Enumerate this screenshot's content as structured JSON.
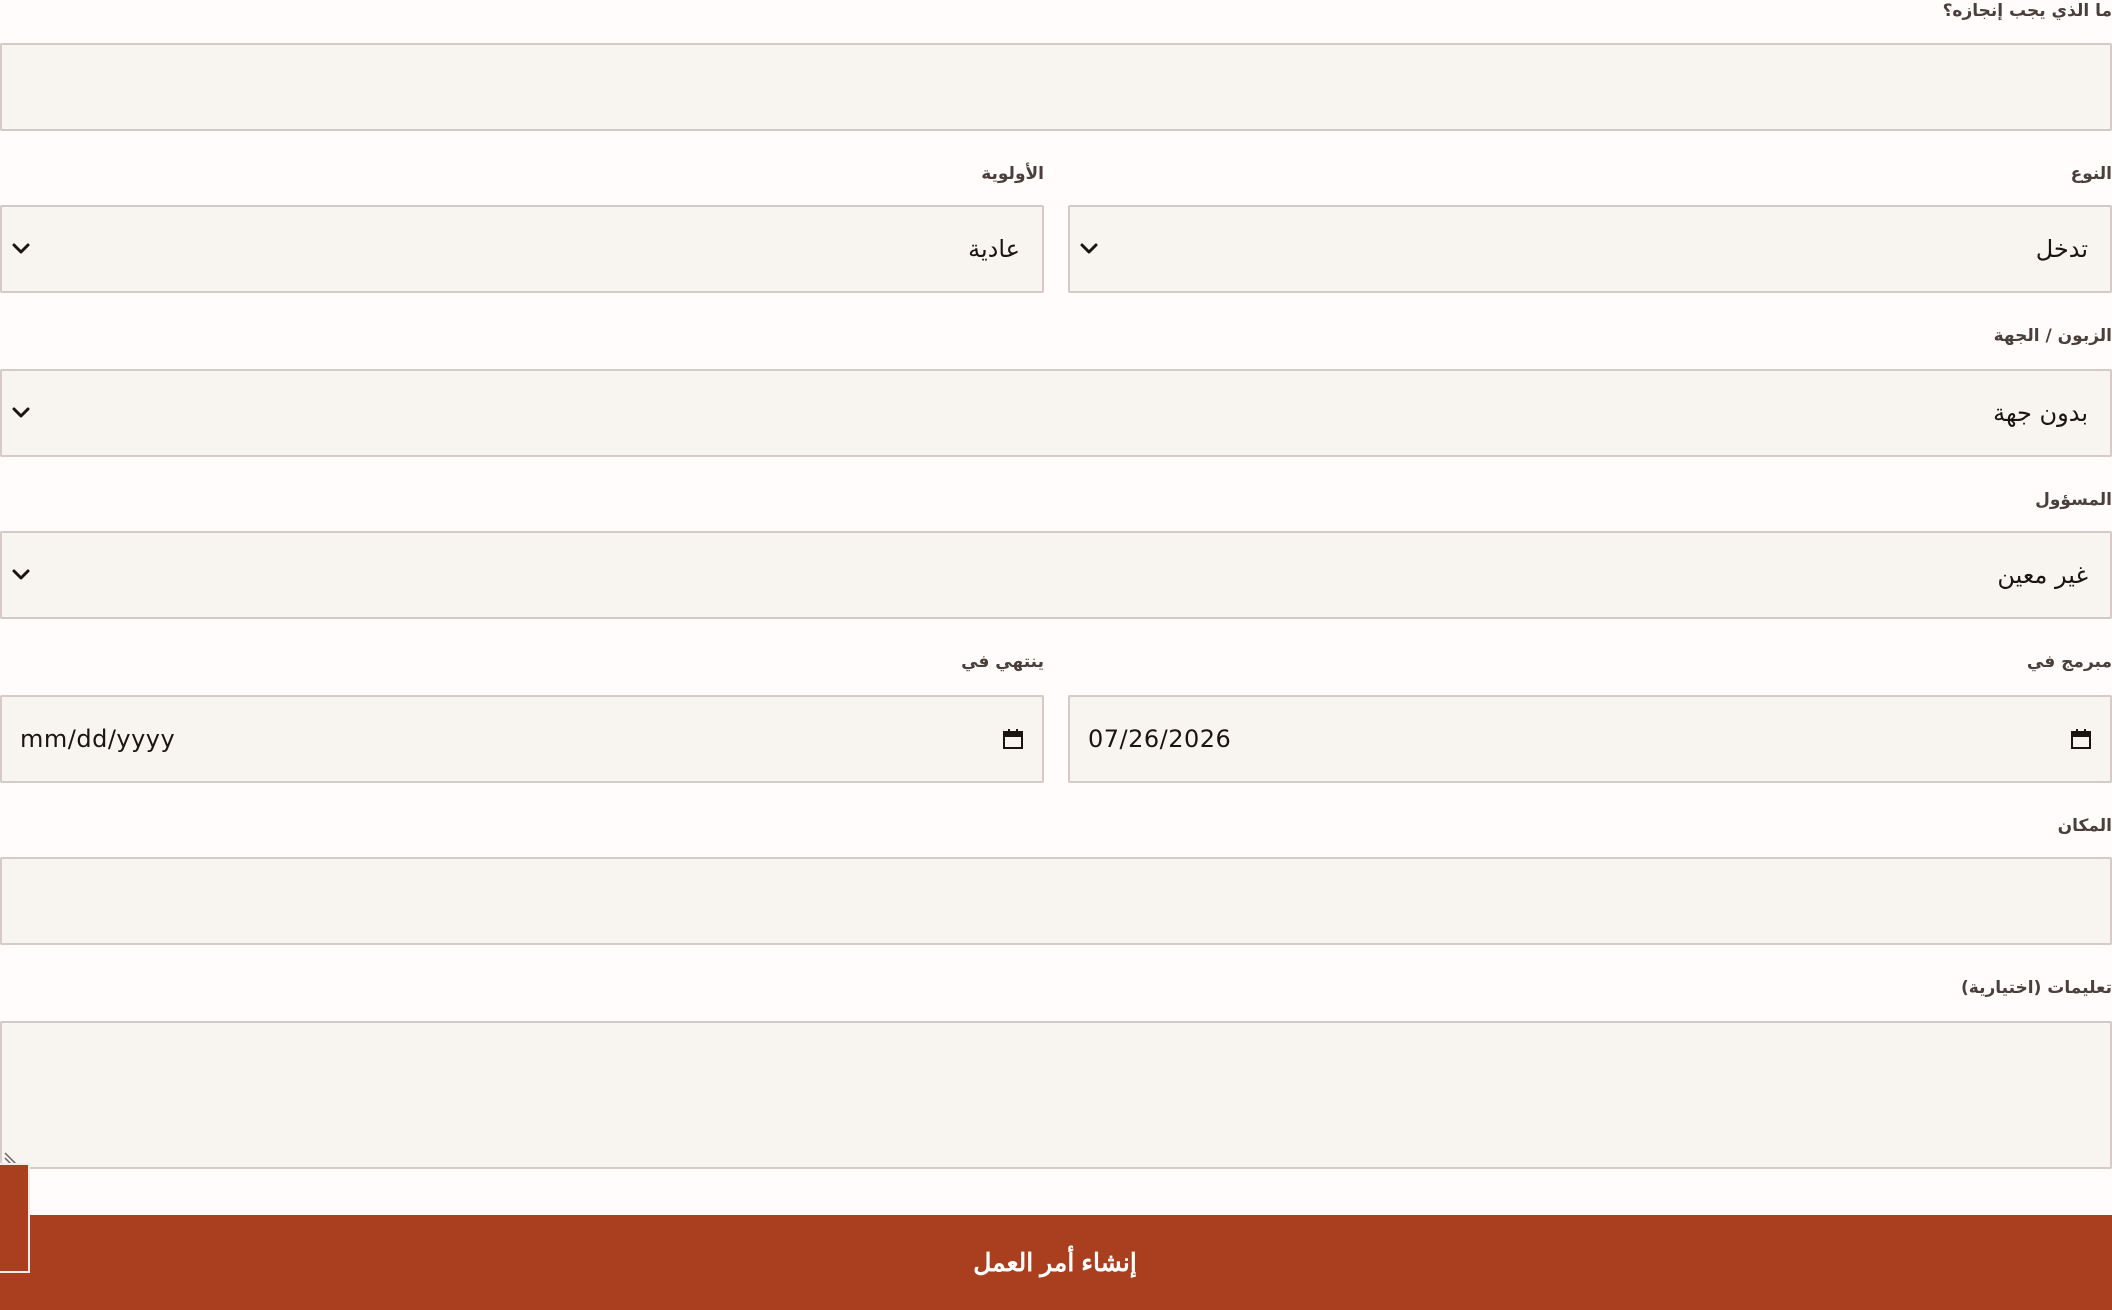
{
  "form": {
    "task": {
      "label": "ما الذي يجب إنجازه؟",
      "value": ""
    },
    "type": {
      "label": "النوع",
      "selected": "تدخل"
    },
    "priority": {
      "label": "الأولوية",
      "selected": "عادية"
    },
    "client": {
      "label": "الزبون / الجهة",
      "selected": "بدون جهة"
    },
    "assignee": {
      "label": "المسؤول",
      "selected": "غير معين"
    },
    "scheduled": {
      "label": "مبرمج في",
      "value": "07/26/2026"
    },
    "due": {
      "label": "ينتهي في",
      "placeholder": "mm/dd/yyyy"
    },
    "location": {
      "label": "المكان",
      "value": ""
    },
    "instructions": {
      "label": "تعليمات (اختيارية)",
      "value": ""
    },
    "submit_label": "إنشاء أمر العمل"
  },
  "colors": {
    "accent": "#aa3f1f",
    "field_background": "#f8f4ef",
    "field_border": "#d5cac5",
    "page_background": "#fffcfb"
  },
  "icons": {
    "select_indicator": "chevron-down-icon",
    "date_picker": "calendar-icon",
    "textarea_resize": "resize-handle-icon"
  }
}
